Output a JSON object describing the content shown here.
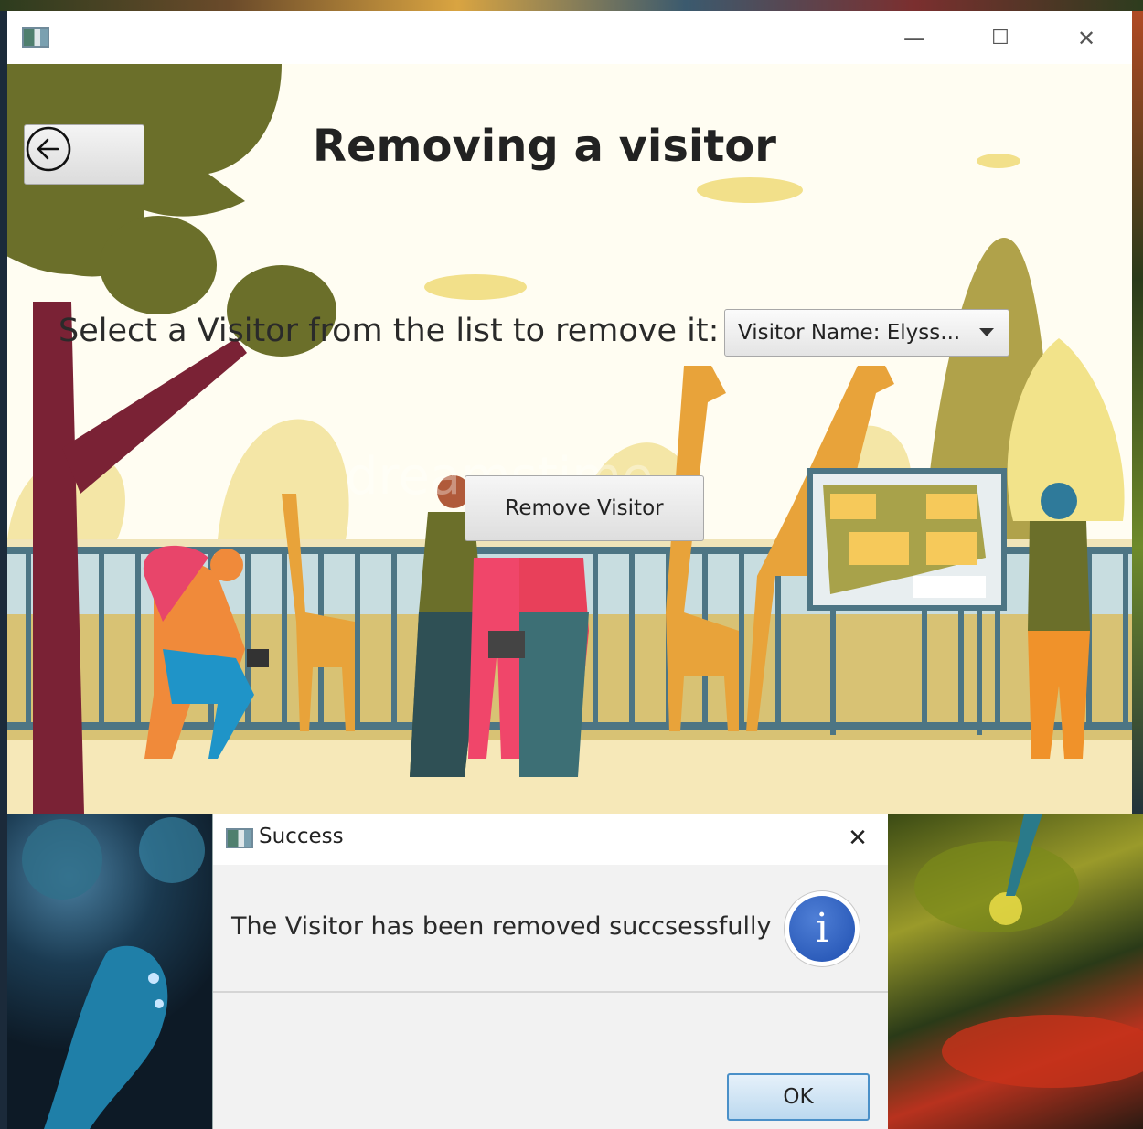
{
  "window": {
    "icon": "app-window-icon",
    "controls": {
      "minimize": "—",
      "maximize": "☐",
      "close": "✕"
    }
  },
  "header": {
    "back_icon": "back-arrow-circle-icon",
    "title": "Removing a visitor"
  },
  "form": {
    "prompt": "Select a Visitor from the list to remove it:",
    "visitor_select_value": "Visitor Name: Elyss...",
    "remove_button": "Remove Visitor"
  },
  "dialog": {
    "title": "Success",
    "close": "✕",
    "message": "The Visitor has been removed succsessfully",
    "info_icon": "i",
    "ok_button": "OK"
  },
  "colors": {
    "title_text": "#222222",
    "tree_green": "#6b6f2a",
    "tree_trunk": "#7a2235",
    "giraffe": "#e8a33a",
    "fence": "#4d7584",
    "info_blue": "#1f4fb0",
    "ok_border": "#4a90c8"
  }
}
